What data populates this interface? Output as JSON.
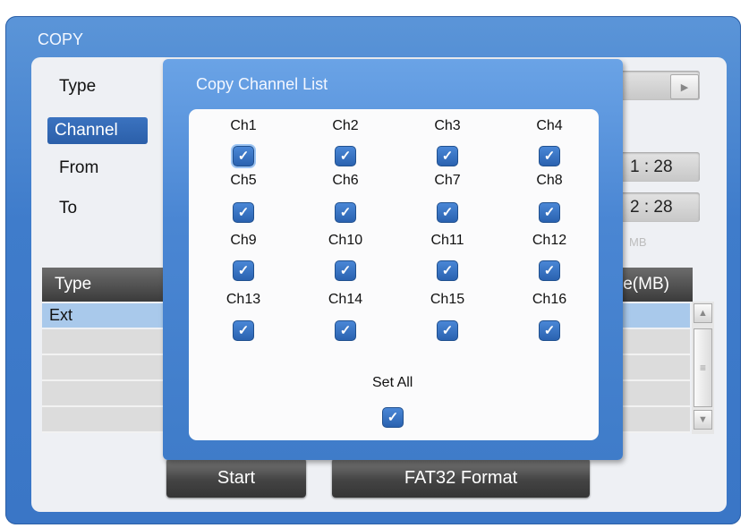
{
  "window": {
    "title": "COPY"
  },
  "form": {
    "type_label": "Type",
    "channel_label": "Channel",
    "from_label": "From",
    "to_label": "To",
    "from_value_partial": "1 : 28",
    "to_value_partial": "2 : 28",
    "size_unit_partial": "MB"
  },
  "table": {
    "headers": {
      "type": "Type",
      "size": "le(MB)"
    },
    "rows": [
      {
        "type": "Ext"
      }
    ]
  },
  "buttons": {
    "start": "Start",
    "format": "FAT32 Format"
  },
  "dialog": {
    "title": "Copy Channel List",
    "channels": [
      {
        "label": "Ch1",
        "checked": true
      },
      {
        "label": "Ch2",
        "checked": true
      },
      {
        "label": "Ch3",
        "checked": true
      },
      {
        "label": "Ch4",
        "checked": true
      },
      {
        "label": "Ch5",
        "checked": true
      },
      {
        "label": "Ch6",
        "checked": true
      },
      {
        "label": "Ch7",
        "checked": true
      },
      {
        "label": "Ch8",
        "checked": true
      },
      {
        "label": "Ch9",
        "checked": true
      },
      {
        "label": "Ch10",
        "checked": true
      },
      {
        "label": "Ch11",
        "checked": true
      },
      {
        "label": "Ch12",
        "checked": true
      },
      {
        "label": "Ch13",
        "checked": true
      },
      {
        "label": "Ch14",
        "checked": true
      },
      {
        "label": "Ch15",
        "checked": true
      },
      {
        "label": "Ch16",
        "checked": true
      }
    ],
    "set_all_label": "Set All",
    "set_all_checked": true
  },
  "colors": {
    "window_blue": "#3f7ccb",
    "checkbox_blue": "#2a62b0",
    "selection": "#a9c9eb"
  },
  "icons": {
    "checkbox": "checkmark-icon",
    "dropdown": "triangle-right-icon"
  }
}
